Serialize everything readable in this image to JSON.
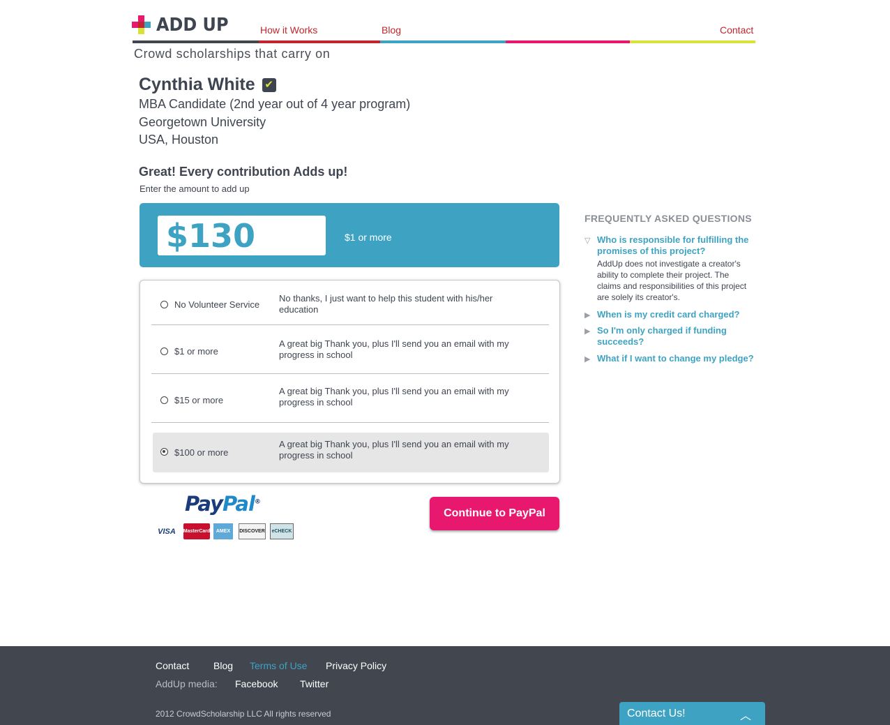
{
  "brand": {
    "logo_text": "ADD UP",
    "tagline": "Crowd scholarships that carry on"
  },
  "nav": {
    "how_it_works": "How it Works",
    "blog": "Blog",
    "contact": "Contact"
  },
  "colors": {
    "red": "#c0262d",
    "blue": "#3ea3c2",
    "magenta": "#e8186f",
    "yellow": "#d8e23a",
    "dark": "#3f4550"
  },
  "profile": {
    "name": "Cynthia White",
    "verified_icon": "check-icon",
    "program": "MBA Candidate (2nd year out of 4 year program)",
    "school": "Georgetown University",
    "location": "USA, Houston"
  },
  "contribution": {
    "title": "Great! Every contribution Adds up!",
    "subtitle": "Enter the amount to add up",
    "amount": "$130",
    "amount_hint": "$1 or more"
  },
  "rewards": [
    {
      "label": "No Volunteer Service",
      "description": "No thanks, I just want to help this student with his/her education",
      "selected": false
    },
    {
      "label": "$1 or more",
      "description": "A great big Thank you, plus I'll send you an email with my progress in school",
      "selected": false
    },
    {
      "label": "$15 or more",
      "description": "A great big Thank you, plus I'll send you an email with my progress in school",
      "selected": false
    },
    {
      "label": "$100 or more",
      "description": "A great big Thank you, plus I'll send you an email with my progress in school",
      "selected": true
    }
  ],
  "payment": {
    "paypal_pay": "Pay",
    "paypal_pal": "Pal",
    "paypal_mark": "®",
    "cards": [
      "VISA",
      "MasterCard",
      "AMEX",
      "DISCOVER",
      "eCHECK"
    ],
    "continue_label": "Continue to PayPal"
  },
  "faq": {
    "title": "FREQUENTLY ASKED QUESTIONS",
    "items": [
      {
        "question": "Who is responsible for fulfilling the promises of this project?",
        "answer": "AddUp does not investigate a creator's ability to complete their project. The claims and responsibilities of this project are solely its creator's.",
        "expanded": true
      },
      {
        "question": "When is my credit card charged?",
        "expanded": false
      },
      {
        "question": "So I'm only charged if funding succeeds?",
        "expanded": false
      },
      {
        "question": "What if I want to change my pledge?",
        "expanded": false
      }
    ]
  },
  "footer": {
    "contact": "Contact",
    "blog": "Blog",
    "terms": "Terms of Use",
    "privacy": "Privacy Policy",
    "media_label": "AddUp media:",
    "facebook": "Facebook",
    "twitter": "Twitter",
    "copyright": "2012 CrowdScholarship LLC All rights reserved"
  },
  "contact_widget": {
    "label": "Contact Us!",
    "icon": "chevron-up-icon"
  }
}
